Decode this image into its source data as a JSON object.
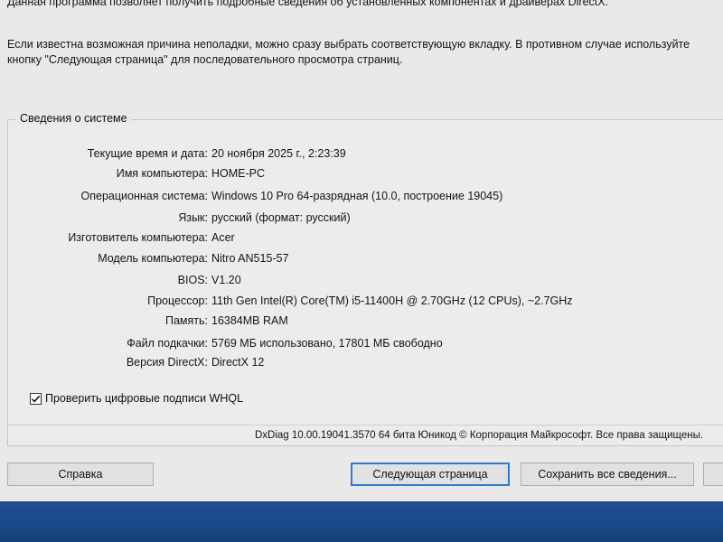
{
  "intro": {
    "line1": "Данная программа позволяет получить подробные сведения об установленных компонентах и драйверах DirectX.",
    "line2": "Если известна возможная причина неполадки, можно сразу выбрать соответствующую вкладку. В противном случае используйте кнопку \"Следующая страница\" для последовательного просмотра страниц."
  },
  "system_info": {
    "title": "Сведения о системе",
    "rows": [
      {
        "label": "Текущие время и дата:",
        "value": "20 ноября 2025 г., 2:23:39"
      },
      {
        "label": "Имя компьютера:",
        "value": "HOME-PC"
      },
      {
        "label": "Операционная система:",
        "value": "Windows 10 Pro 64-разрядная (10.0, построение 19045)"
      },
      {
        "label": "Язык:",
        "value": "русский (формат: русский)"
      },
      {
        "label": "Изготовитель компьютера:",
        "value": "Acer"
      },
      {
        "label": "Модель компьютера:",
        "value": "Nitro AN515-57"
      },
      {
        "label": "BIOS:",
        "value": "V1.20"
      },
      {
        "label": "Процессор:",
        "value": "11th Gen Intel(R) Core(TM) i5-11400H @ 2.70GHz (12 CPUs), ~2.7GHz"
      },
      {
        "label": "Память:",
        "value": "16384MB RAM"
      },
      {
        "label": "Файл подкачки:",
        "value": "5769 МБ использовано, 17801 МБ свободно"
      },
      {
        "label": "Версия DirectX:",
        "value": "DirectX 12"
      }
    ]
  },
  "whql": {
    "label": "Проверить цифровые подписи WHQL",
    "checked": true
  },
  "copyright": "DxDiag 10.00.19041.3570 64 бита Юникод © Корпорация Майкрософт. Все права защищены.",
  "buttons": {
    "help": "Справка",
    "next": "Следующая страница",
    "save": "Сохранить все сведения..."
  },
  "colors": {
    "window_bg": "#e9e9ea",
    "focus_border": "#2a7bd3",
    "taskbar": "#1b4a8b"
  }
}
